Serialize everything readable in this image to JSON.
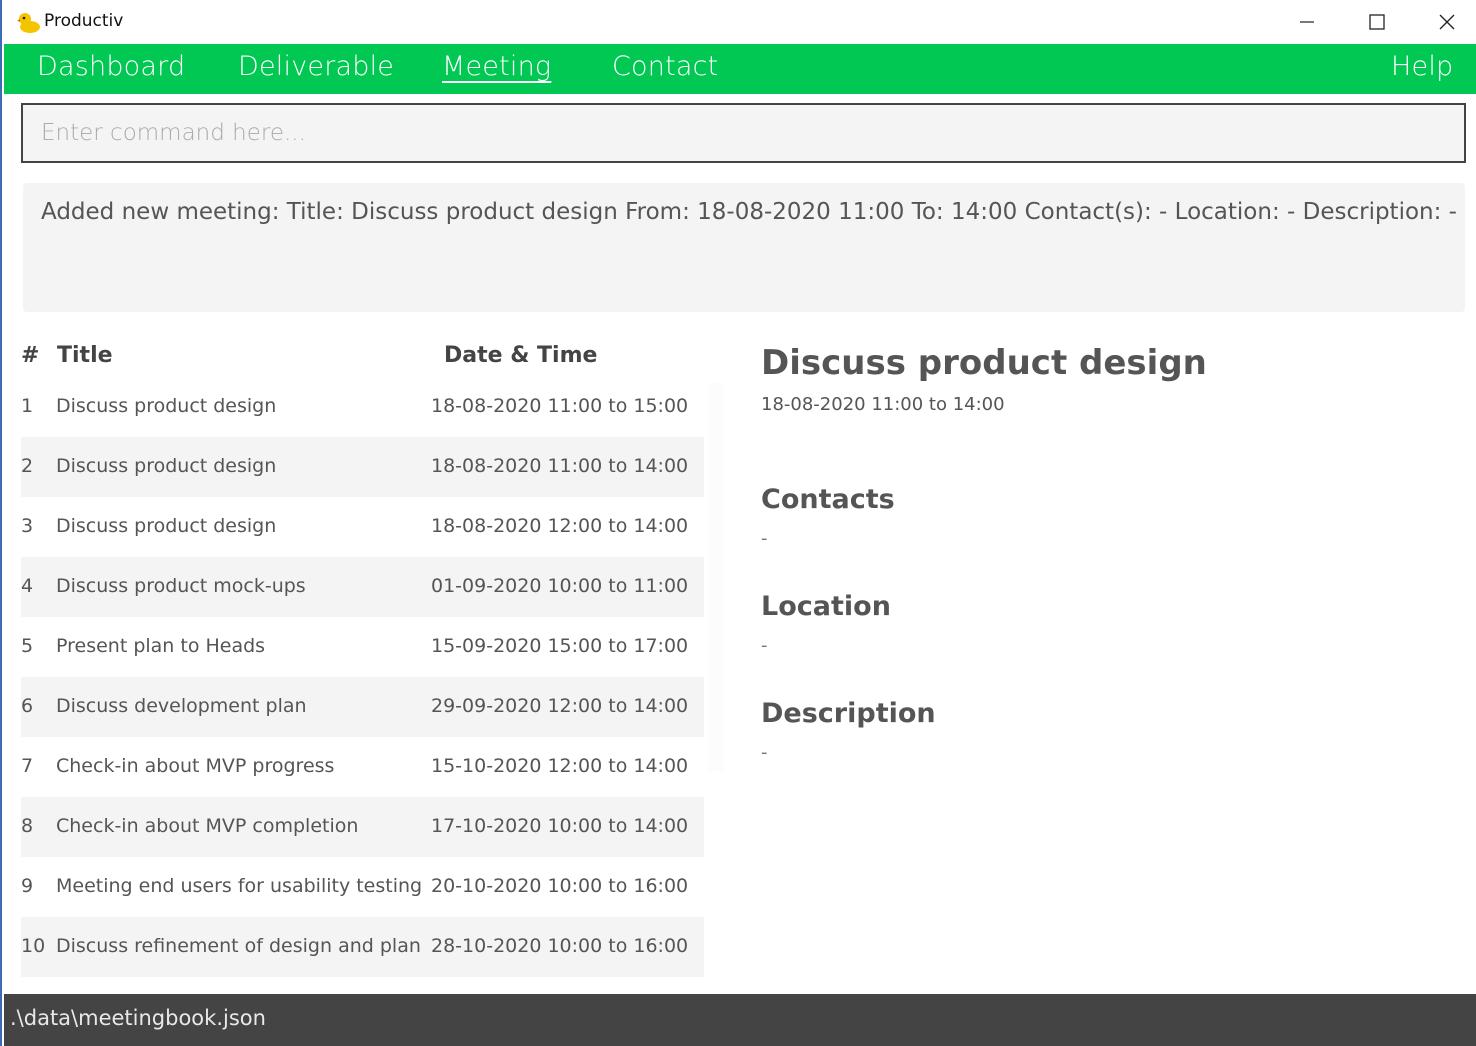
{
  "window": {
    "title": "Productiv",
    "icon": "rubber-duck-icon",
    "controls": [
      "minimize-icon",
      "maximize-icon",
      "close-icon"
    ]
  },
  "menu": {
    "items": [
      "Dashboard",
      "Deliverable",
      "Meeting",
      "Contact"
    ],
    "active": "Meeting",
    "help": "Help",
    "background": "#00c853"
  },
  "command": {
    "placeholder": "Enter command here...",
    "value": ""
  },
  "result": {
    "text": "Added new meeting: Title: Discuss product design From: 18-08-2020 11:00 To: 14:00 Contact(s): - Location: - Description: -"
  },
  "list": {
    "headers": {
      "index": "#",
      "title": "Title",
      "datetime": "Date & Time"
    },
    "rows": [
      {
        "index": "1",
        "title": "Discuss product design",
        "datetime": "18-08-2020 11:00 to 15:00"
      },
      {
        "index": "2",
        "title": "Discuss product design",
        "datetime": "18-08-2020 11:00 to 14:00"
      },
      {
        "index": "3",
        "title": "Discuss product design",
        "datetime": "18-08-2020 12:00 to 14:00"
      },
      {
        "index": "4",
        "title": "Discuss product mock-ups",
        "datetime": "01-09-2020 10:00 to 11:00"
      },
      {
        "index": "5",
        "title": "Present plan to Heads",
        "datetime": "15-09-2020 15:00 to 17:00"
      },
      {
        "index": "6",
        "title": "Discuss development plan",
        "datetime": "29-09-2020 12:00 to 14:00"
      },
      {
        "index": "7",
        "title": "Check-in about MVP progress",
        "datetime": "15-10-2020 12:00 to 14:00"
      },
      {
        "index": "8",
        "title": "Check-in about MVP completion",
        "datetime": "17-10-2020 10:00 to 14:00"
      },
      {
        "index": "9",
        "title": "Meeting end users for usability testing",
        "datetime": "20-10-2020 10:00 to 16:00"
      },
      {
        "index": "10",
        "title": "Discuss refinement of design and plan",
        "datetime": "28-10-2020 10:00 to 16:00"
      }
    ]
  },
  "detail": {
    "title": "Discuss product design",
    "datetime": "18-08-2020 11:00 to 14:00",
    "contacts_label": "Contacts",
    "contacts_value": "-",
    "location_label": "Location",
    "location_value": "-",
    "description_label": "Description",
    "description_value": "-"
  },
  "status": {
    "path": ".\\data\\meetingbook.json"
  }
}
